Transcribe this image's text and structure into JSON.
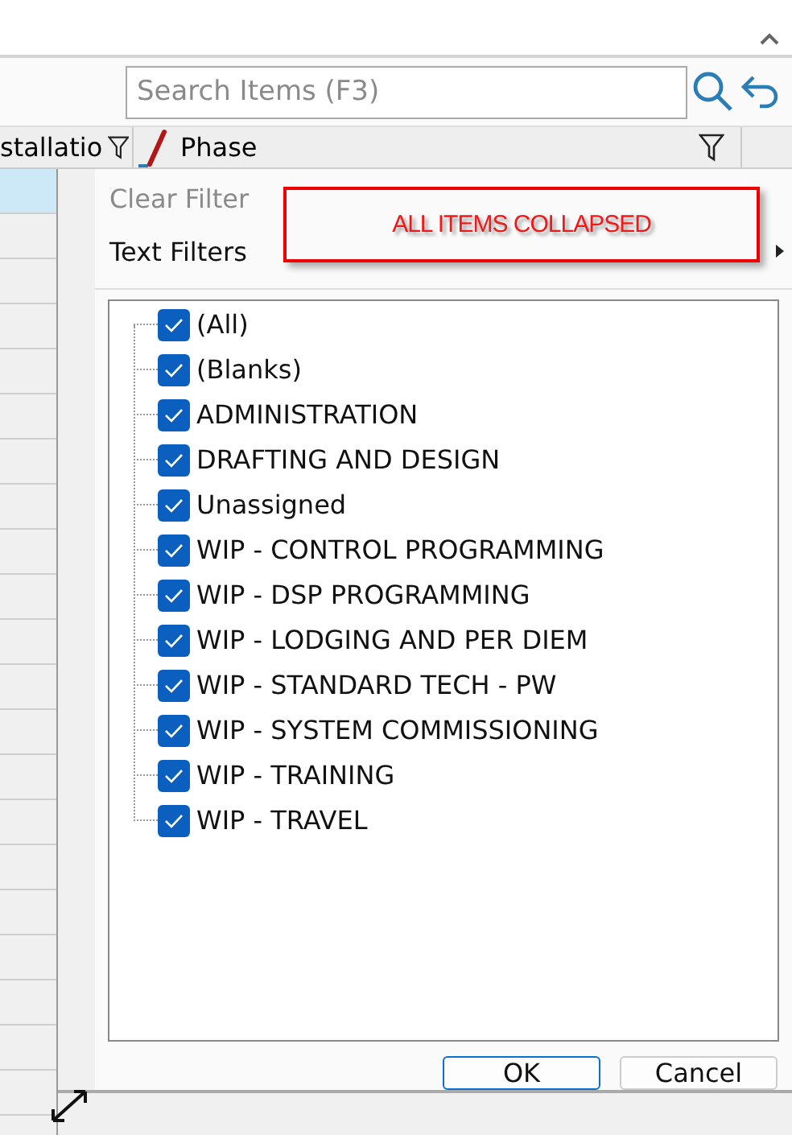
{
  "search": {
    "placeholder": "Search Items (F3)"
  },
  "columns": [
    {
      "label": "stallatio",
      "kind": "text"
    },
    {
      "label": "Phase",
      "kind": "editable"
    }
  ],
  "grid": {
    "rows": [
      {
        "selected": true
      },
      {
        "selected": false
      },
      {
        "selected": false
      },
      {
        "selected": false
      },
      {
        "selected": false
      },
      {
        "selected": false
      },
      {
        "selected": false
      },
      {
        "selected": false
      },
      {
        "selected": false
      },
      {
        "selected": false
      },
      {
        "selected": false
      },
      {
        "selected": false
      },
      {
        "selected": false
      },
      {
        "selected": false
      },
      {
        "selected": false
      },
      {
        "selected": false
      },
      {
        "selected": false
      },
      {
        "selected": false
      },
      {
        "selected": false
      },
      {
        "selected": false
      },
      {
        "selected": false
      }
    ]
  },
  "filter_menu": {
    "items": [
      {
        "label": "Clear Filter",
        "disabled": true,
        "submenu": false
      },
      {
        "label": "Text Filters",
        "disabled": false,
        "submenu": true
      }
    ],
    "annotation": "ALL ITEMS COLLAPSED",
    "values": [
      {
        "label": "(All)",
        "checked": true
      },
      {
        "label": "(Blanks)",
        "checked": true
      },
      {
        "label": "ADMINISTRATION",
        "checked": true
      },
      {
        "label": "DRAFTING AND DESIGN",
        "checked": true
      },
      {
        "label": "Unassigned",
        "checked": true
      },
      {
        "label": "WIP - CONTROL PROGRAMMING",
        "checked": true
      },
      {
        "label": "WIP - DSP PROGRAMMING",
        "checked": true
      },
      {
        "label": "WIP - LODGING AND PER DIEM",
        "checked": true
      },
      {
        "label": "WIP - STANDARD TECH - PW",
        "checked": true
      },
      {
        "label": "WIP - SYSTEM COMMISSIONING",
        "checked": true
      },
      {
        "label": "WIP - TRAINING",
        "checked": true
      },
      {
        "label": "WIP - TRAVEL",
        "checked": true
      }
    ],
    "buttons": [
      {
        "label": "OK",
        "default": true
      },
      {
        "label": "Cancel",
        "default": false
      }
    ]
  }
}
